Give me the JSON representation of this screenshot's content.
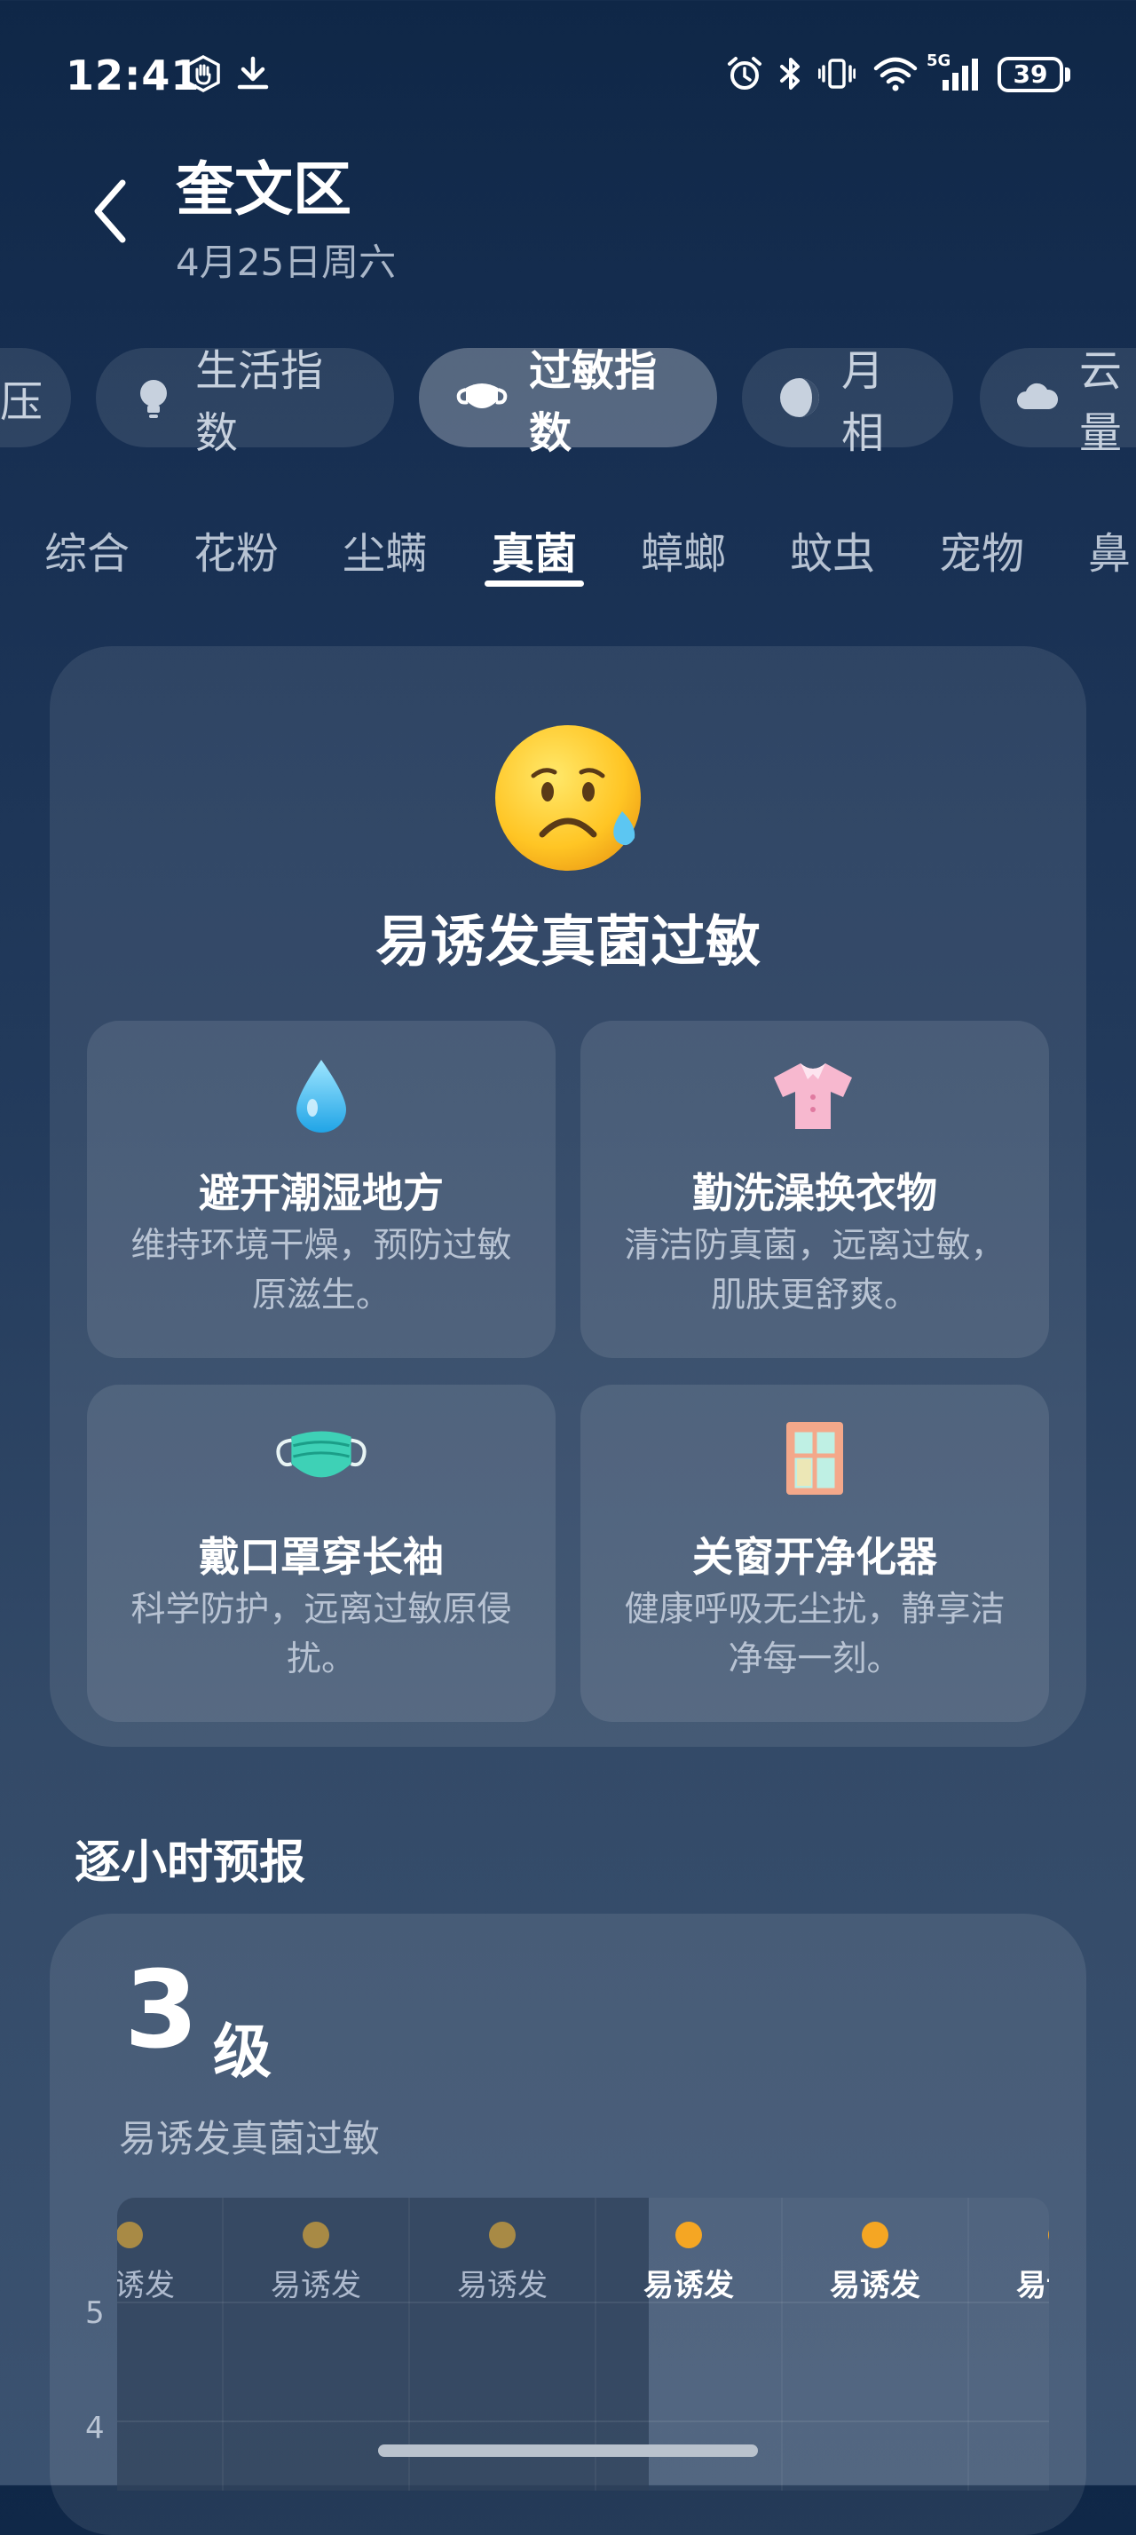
{
  "status_bar": {
    "time": "12:41",
    "network": "5G",
    "battery": "39",
    "icons": [
      "hand-icon",
      "download-icon",
      "alarm-icon",
      "bluetooth-icon",
      "vibrate-icon",
      "wifi-icon",
      "signal-icon",
      "battery-icon"
    ]
  },
  "header": {
    "title": "奎文区",
    "date": "4月25日周六",
    "back_icon": "back-arrow-icon"
  },
  "categories": [
    {
      "label": "压",
      "icon": "pressure-icon",
      "active": false
    },
    {
      "label": "生活指数",
      "icon": "lightbulb-icon",
      "active": false
    },
    {
      "label": "过敏指数",
      "icon": "mask-icon",
      "active": true
    },
    {
      "label": "月相",
      "icon": "moon-phase-icon",
      "active": false
    },
    {
      "label": "云量",
      "icon": "cloud-icon",
      "active": false
    }
  ],
  "subtabs": [
    {
      "label": "综合",
      "active": false
    },
    {
      "label": "花粉",
      "active": false
    },
    {
      "label": "尘螨",
      "active": false
    },
    {
      "label": "真菌",
      "active": true
    },
    {
      "label": "蟑螂",
      "active": false
    },
    {
      "label": "蚊虫",
      "active": false
    },
    {
      "label": "宠物",
      "active": false
    },
    {
      "label": "鼻",
      "active": false
    }
  ],
  "summary": {
    "emoji": "worried-sweat-face-icon",
    "title": "易诱发真菌过敏"
  },
  "tips": [
    {
      "icon": "water-drop-icon",
      "title": "避开潮湿地方",
      "desc": "维持环境干燥，预防过敏原滋生。"
    },
    {
      "icon": "shirt-icon",
      "title": "勤洗澡换衣物",
      "desc": "清洁防真菌，远离过敏，肌肤更舒爽。"
    },
    {
      "icon": "face-mask-icon",
      "title": "戴口罩穿长袖",
      "desc": "科学防护，远离过敏原侵扰。"
    },
    {
      "icon": "window-icon",
      "title": "关窗开净化器",
      "desc": "健康呼吸无尘扰，静享洁净每一刻。"
    }
  ],
  "hourly": {
    "section_title": "逐小时预报",
    "level": "3",
    "level_unit": "级",
    "level_desc": "易诱发真菌过敏"
  },
  "chart_data": {
    "type": "line",
    "title": "",
    "xlabel": "",
    "ylabel": "",
    "y_ticks": [
      "5",
      "4"
    ],
    "point_labels": [
      "易诱发",
      "易诱发",
      "易诱发",
      "易诱发",
      "易诱发",
      "易诱发"
    ],
    "past_points": 3,
    "colors": {
      "past": "#a88a45",
      "future": "#f5a623",
      "past_bg": "#2d405a"
    }
  }
}
